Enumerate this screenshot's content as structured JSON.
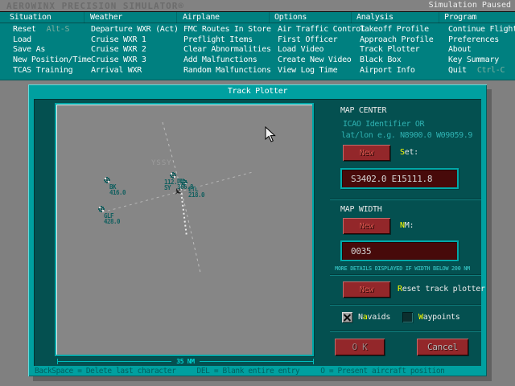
{
  "titlebar": {
    "app_title": "AEROWINX PRECISION SIMULATOR®",
    "status": "Simulation Paused"
  },
  "menu": {
    "columns": [
      {
        "title": "Situation",
        "items": [
          {
            "label": "Reset",
            "shortcut": "Alt-S"
          },
          {
            "label": "Load"
          },
          {
            "label": "Save As"
          },
          {
            "label": "New Position/Time"
          },
          {
            "label": "TCAS Training"
          }
        ]
      },
      {
        "title": "Weather",
        "items": [
          {
            "label": "Departure WXR (Act)"
          },
          {
            "label": "Cruise WXR 1"
          },
          {
            "label": "Cruise WXR 2"
          },
          {
            "label": "Cruise WXR 3"
          },
          {
            "label": "Arrival WXR"
          }
        ]
      },
      {
        "title": "Airplane",
        "items": [
          {
            "label": "FMC Routes In Store"
          },
          {
            "label": "Preflight Items"
          },
          {
            "label": "Clear Abnormalities"
          },
          {
            "label": "Add Malfunctions"
          },
          {
            "label": "Random Malfunctions"
          }
        ]
      },
      {
        "title": "Options",
        "items": [
          {
            "label": "Air Traffic Control"
          },
          {
            "label": "First Officer"
          },
          {
            "label": "Load Video"
          },
          {
            "label": "Create New Video"
          },
          {
            "label": "View Log Time"
          }
        ]
      },
      {
        "title": "Analysis",
        "items": [
          {
            "label": "Takeoff Profile"
          },
          {
            "label": "Approach Profile"
          },
          {
            "label": "Track Plotter"
          },
          {
            "label": "Black Box"
          },
          {
            "label": "Airport Info"
          }
        ]
      },
      {
        "title": "Program",
        "items": [
          {
            "label": "Continue Flight"
          },
          {
            "label": "Preferences"
          },
          {
            "label": "About"
          },
          {
            "label": "Key Summary"
          },
          {
            "label": "Quit",
            "shortcut": "Ctrl-C"
          }
        ]
      }
    ]
  },
  "dialog": {
    "title": "Track Plotter",
    "map": {
      "airport_label": "YSSY",
      "scale_label": "35 NM",
      "navaids": [
        {
          "id": "BK",
          "lines": [
            "BK",
            "416.0"
          ],
          "sym": [
            62,
            93
          ],
          "label": [
            66,
            99
          ]
        },
        {
          "id": "GLF",
          "lines": [
            "GLF",
            "428.0"
          ],
          "sym": [
            55,
            129
          ],
          "label": [
            59,
            135
          ]
        },
        {
          "id": "SY",
          "lines": [
            "112.",
            "SY"
          ],
          "sym": [
            144,
            87
          ],
          "label": [
            134,
            93
          ]
        },
        {
          "id": "DM",
          "lines": [
            "DM.",
            "366.8"
          ],
          "sym": [
            158,
            96
          ],
          "label": [
            150,
            92
          ]
        },
        {
          "id": "ETL",
          "lines": [
            "ETL",
            "218.0"
          ],
          "label": [
            164,
            102
          ]
        }
      ]
    },
    "map_center": {
      "heading": "MAP CENTER",
      "hint_line1": "ICAO Identifier OR",
      "hint_line2": "lat/lon e.g. N8900.0 W09059.9",
      "new_button": "New",
      "set_hotkey": "S",
      "set_rest": "et:",
      "value": "S3402.0 E15111.8"
    },
    "map_width": {
      "heading": "MAP WIDTH",
      "new_button": "New",
      "nm_hotkey": "N",
      "nm_rest": "M:",
      "value": "0035",
      "note": "MORE DETAILS DISPLAYED IF WIDTH BELOW 200 NM"
    },
    "reset_plotter": {
      "new_button": "New",
      "label_hotkey": "R",
      "label_rest": "eset track plotter"
    },
    "toggles": {
      "navaids": {
        "pre": "N",
        "hotkey": "a",
        "rest": "vaids",
        "checked": true
      },
      "waypoints": {
        "pre": "",
        "hotkey": "W",
        "rest": "aypoints",
        "checked": false
      }
    },
    "buttons": {
      "ok": "O K",
      "cancel": "Cancel"
    },
    "footer_hints": [
      "BackSpace = Delete last character",
      "DEL = Blank entire entry",
      "O = Present aircraft position"
    ]
  },
  "colors": {
    "menu_teal": "#008080",
    "dialog_frame": "#00a0a0",
    "dialog_body": "#045050",
    "map_grey": "#868686",
    "button_red": "#93272a",
    "field_red": "#470a0a",
    "hotkey_yellow": "#ffff00",
    "hint_cyan": "#2fb3b3"
  }
}
